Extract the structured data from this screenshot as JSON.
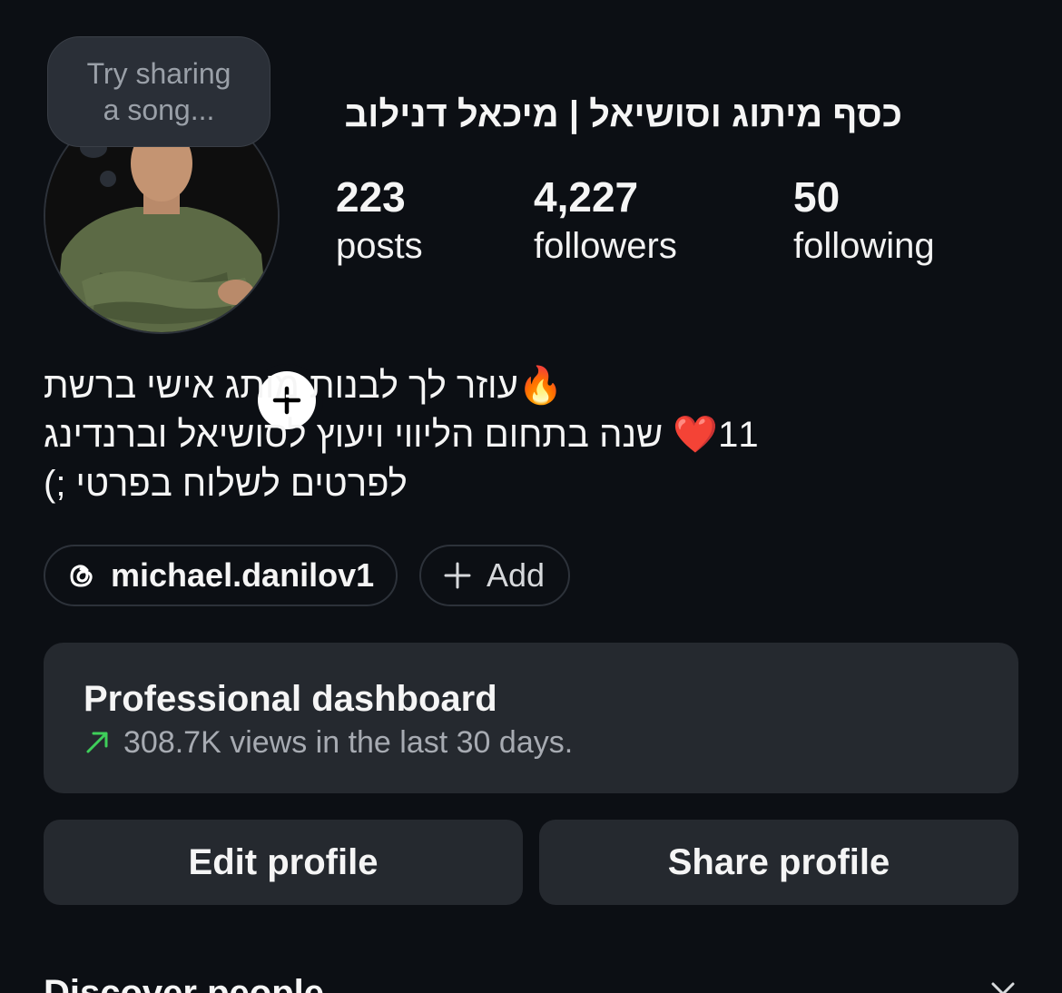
{
  "profile": {
    "display_name": "כסף מיתוג וסושיאל | מיכאל דנילוב",
    "note_line_1": "Try sharing",
    "note_line_2": "a song..."
  },
  "stats": [
    {
      "value": "223",
      "label": "posts"
    },
    {
      "value": "4,227",
      "label": "followers"
    },
    {
      "value": "50",
      "label": "following"
    }
  ],
  "bio": {
    "line_1": "עוזר לך לבנות מותג אישי ברשת",
    "line_1_emoji": "🔥",
    "line_2": "11",
    "line_2_emoji": "❤️",
    "line_2_rest": "שנה בתחום הליווי ויעוץ לסושיאל וברנדינג",
    "line_3": "לפרטים לשלוח בפרטי ;)"
  },
  "links": {
    "threads_handle": "michael.danilov1",
    "add_label": "Add"
  },
  "dashboard": {
    "title": "Professional dashboard",
    "subtitle": "308.7K views in the last 30 days.",
    "trend_color": "#3ecf5a"
  },
  "actions": {
    "edit_label": "Edit profile",
    "share_label": "Share profile"
  },
  "discover": {
    "title": "Discover people"
  }
}
